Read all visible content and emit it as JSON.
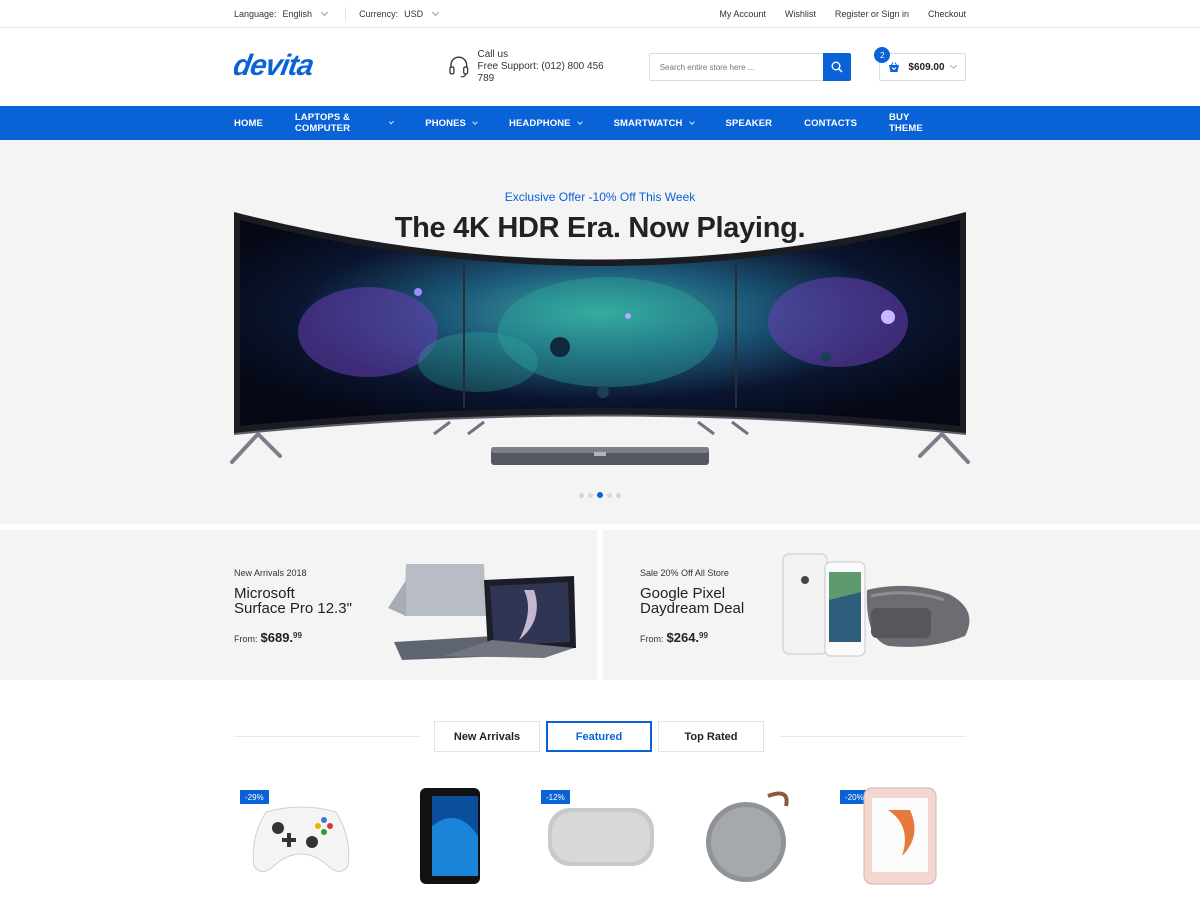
{
  "topbar": {
    "language_label": "Language:",
    "language_value": "English",
    "currency_label": "Currency:",
    "currency_value": "USD",
    "links": [
      "My Account",
      "Wishlist",
      "Register or Sign in",
      "Checkout"
    ]
  },
  "header": {
    "logo_text": "devita",
    "support_line1": "Call us",
    "support_line2": "Free Support: (012) 800 456 789",
    "search_placeholder": "Search entire store here ...",
    "cart_count": "2",
    "cart_total": "$609.00"
  },
  "nav": {
    "items": [
      {
        "label": "HOME"
      },
      {
        "label": "LAPTOPS & COMPUTER"
      },
      {
        "label": "PHONES"
      },
      {
        "label": "HEADPHONE"
      },
      {
        "label": "SMARTWATCH"
      },
      {
        "label": "SPEAKER"
      },
      {
        "label": "CONTACTS"
      },
      {
        "label": "BUY THEME"
      }
    ]
  },
  "hero": {
    "offer": "Exclusive Offer -10% Off This Week",
    "title": "The 4K HDR Era. Now Playing.",
    "slide_count": 5,
    "active_slide": 3
  },
  "banners": [
    {
      "tag": "New Arrivals 2018",
      "name_line1": "Microsoft",
      "name_line2": "Surface Pro 12.3\"",
      "from": "From:",
      "price": "$689.",
      "cents": "99"
    },
    {
      "tag": "Sale 20% Off All Store",
      "name_line1": "Google Pixel",
      "name_line2": "Daydream Deal",
      "from": "From:",
      "price": "$264.",
      "cents": "99"
    }
  ],
  "tabs": [
    {
      "label": "New Arrivals"
    },
    {
      "label": "Featured"
    },
    {
      "label": "Top Rated"
    }
  ],
  "products": {
    "badges": [
      "-29%",
      "-12%",
      "-20%"
    ],
    "items": [
      "game-controller",
      "smartphone",
      "speaker-grey",
      "speaker-round",
      "iphone-rose"
    ]
  },
  "colors": {
    "accent": "#0a63d6",
    "hero_bg": "#f4f4f4"
  }
}
